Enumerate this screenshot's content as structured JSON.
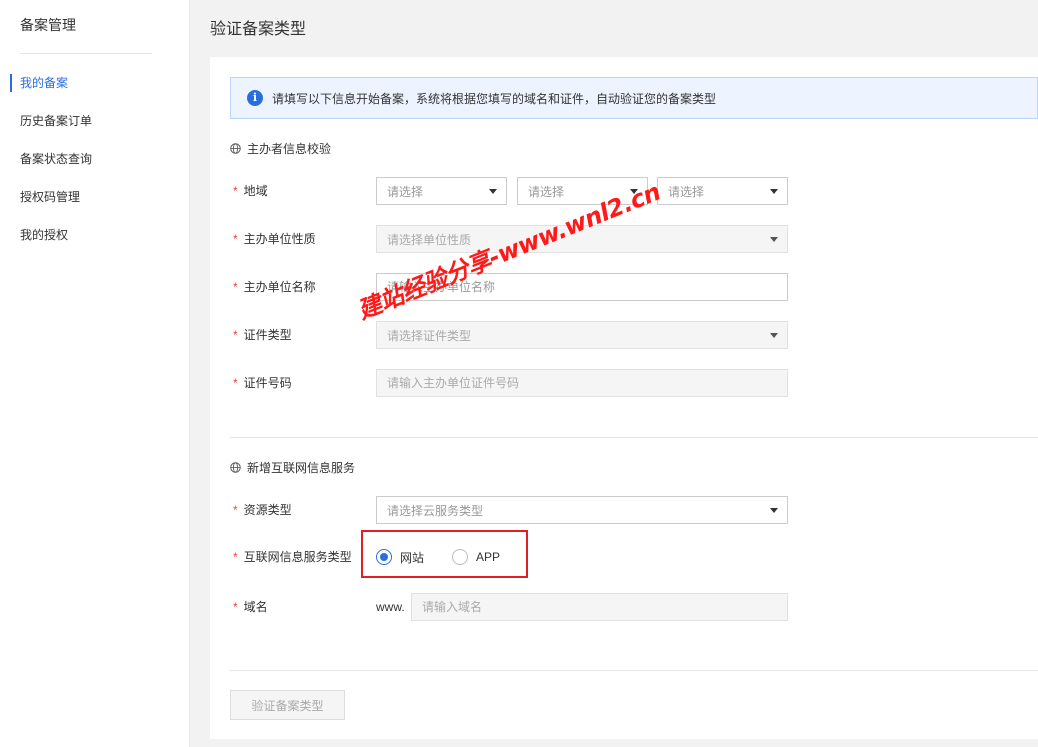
{
  "sidebar": {
    "title": "备案管理",
    "items": [
      {
        "label": "我的备案",
        "active": true
      },
      {
        "label": "历史备案订单",
        "active": false
      },
      {
        "label": "备案状态查询",
        "active": false
      },
      {
        "label": "授权码管理",
        "active": false
      },
      {
        "label": "我的授权",
        "active": false
      }
    ]
  },
  "page": {
    "title": "验证备案类型"
  },
  "info_bar": {
    "icon": "info-icon",
    "text": "请填写以下信息开始备案，系统将根据您填写的域名和证件，自动验证您的备案类型"
  },
  "sponsor_section": {
    "title": "主办者信息校验",
    "region": {
      "label": "地域",
      "selects": [
        "请选择",
        "请选择",
        "请选择"
      ]
    },
    "org_type": {
      "label": "主办单位性质",
      "placeholder": "请选择单位性质"
    },
    "org_name": {
      "label": "主办单位名称",
      "placeholder": "请输入主办单位名称"
    },
    "cert_type": {
      "label": "证件类型",
      "placeholder": "请选择证件类型"
    },
    "cert_number": {
      "label": "证件号码",
      "placeholder": "请输入主办单位证件号码"
    }
  },
  "service_section": {
    "title": "新增互联网信息服务",
    "resource_type": {
      "label": "资源类型",
      "placeholder": "请选择云服务类型"
    },
    "service_type": {
      "label": "互联网信息服务类型",
      "options": [
        {
          "label": "网站",
          "checked": true
        },
        {
          "label": "APP",
          "checked": false
        }
      ]
    },
    "domain": {
      "label": "域名",
      "prefix": "www.",
      "placeholder": "请输入域名"
    }
  },
  "submit_label": "验证备案类型",
  "watermark": "建站经验分享-www.wnl2.cn",
  "colors": {
    "accent": "#2a6ede",
    "required": "#f04134",
    "highlight": "#e02020"
  }
}
